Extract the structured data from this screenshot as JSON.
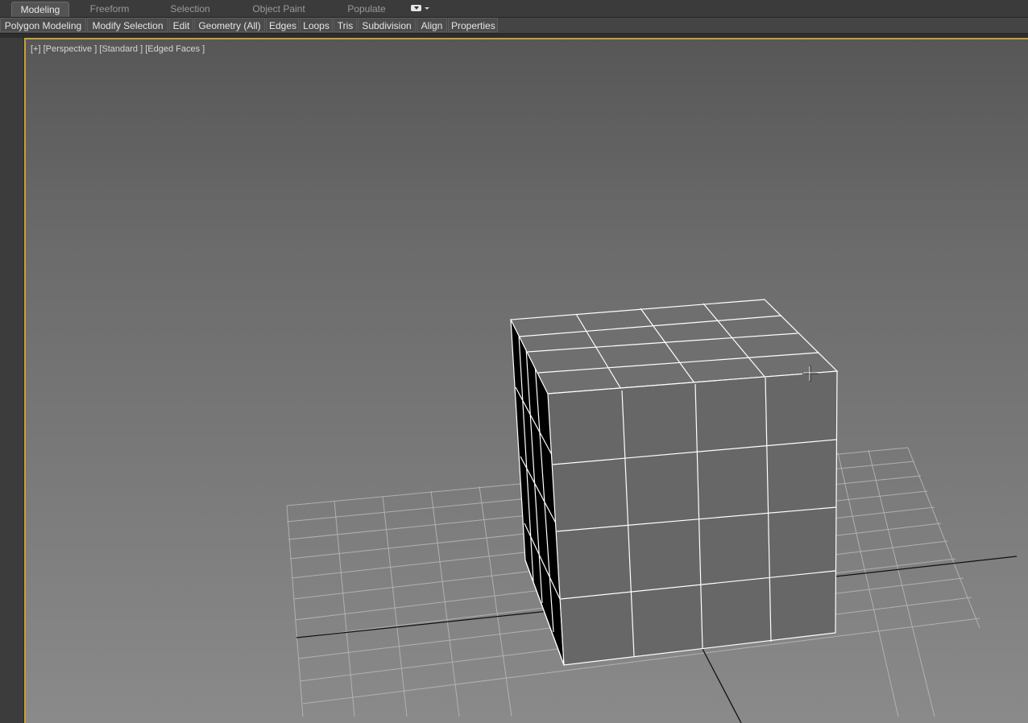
{
  "tabs": [
    {
      "label": "Modeling",
      "active": true
    },
    {
      "label": "Freeform",
      "active": false
    },
    {
      "label": "Selection",
      "active": false
    },
    {
      "label": "Object Paint",
      "active": false
    },
    {
      "label": "Populate",
      "active": false
    }
  ],
  "ribbon": [
    "Polygon Modeling",
    "Modify Selection",
    "Edit",
    "Geometry (All)",
    "Edges",
    "Loops",
    "Tris",
    "Subdivision",
    "Align",
    "Properties"
  ],
  "viewport": {
    "menu_plus": "[+]",
    "view_label": "[Perspective ]",
    "shading_label": "[Standard ]",
    "display_label": "[Edged Faces ]"
  },
  "colors": {
    "active_viewport_border": "#c4a23c",
    "wire": "#ffffff",
    "grid": "#b9b9b9"
  },
  "icons": {
    "tab_overflow": "chevron-down-icon",
    "cursor": "crosshair-cursor-icon"
  }
}
